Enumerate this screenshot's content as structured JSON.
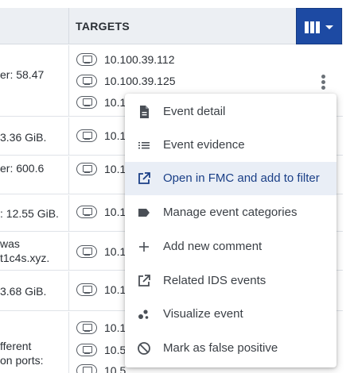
{
  "table": {
    "header": {
      "targets_label": "TARGETS"
    },
    "rows": [
      {
        "desc": [
          "er: 58.47"
        ],
        "targets": [
          "10.100.39.112",
          "10.100.39.125",
          "10.1"
        ]
      },
      {
        "desc": [
          "3.36 GiB."
        ],
        "targets": [
          "10.1"
        ]
      },
      {
        "desc": [
          "er: 600.6"
        ],
        "targets": [
          "10.1"
        ]
      },
      {
        "desc": [
          ": 12.55 GiB."
        ],
        "targets": [
          "10.1"
        ]
      },
      {
        "desc": [
          " was",
          "t1c4s.xyz."
        ],
        "targets": [
          "10.1"
        ]
      },
      {
        "desc": [
          "3.68 GiB."
        ],
        "targets": [
          "10.1"
        ]
      },
      {
        "desc": [
          "fferent",
          "on ports:"
        ],
        "targets": [
          "10.1",
          "10.5",
          "10.5"
        ]
      }
    ]
  },
  "context_menu": {
    "items": [
      {
        "label": "Event detail",
        "icon": "document-icon"
      },
      {
        "label": "Event evidence",
        "icon": "list-icon"
      },
      {
        "label": "Open in FMC and add to filter",
        "icon": "external-link-icon",
        "active": true
      },
      {
        "label": "Manage event categories",
        "icon": "label-tag-icon"
      },
      {
        "label": "Add new comment",
        "icon": "plus-icon"
      },
      {
        "label": "Related IDS events",
        "icon": "external-link-icon"
      },
      {
        "label": "Visualize event",
        "icon": "bubble-icon"
      },
      {
        "label": "Mark as false positive",
        "icon": "block-icon"
      }
    ]
  },
  "colors": {
    "accent": "#1d4aa3",
    "menu_active_bg": "#e9eef6",
    "header_bg": "#eceff3"
  }
}
